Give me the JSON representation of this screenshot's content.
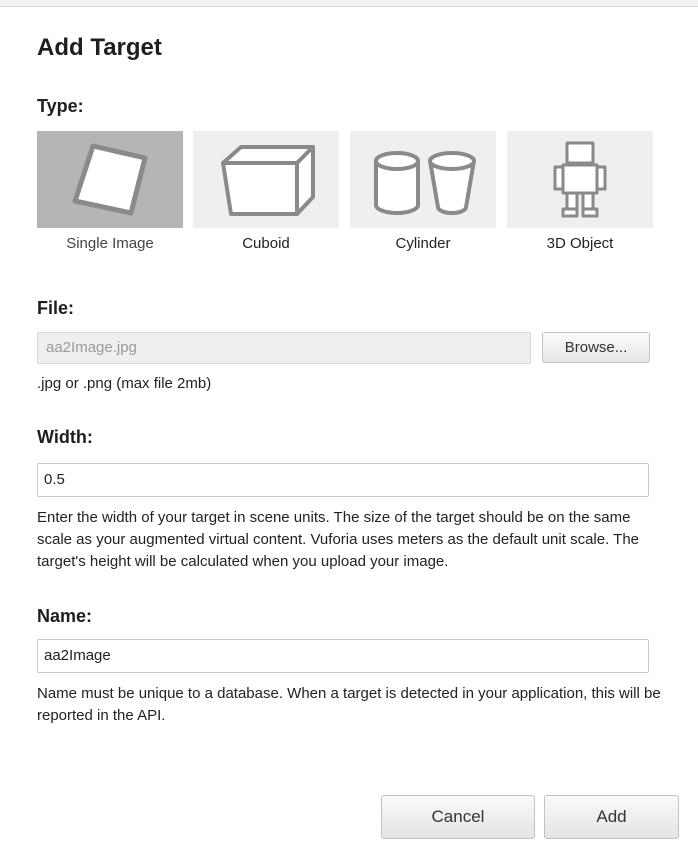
{
  "dialog": {
    "title": "Add Target"
  },
  "type_section": {
    "label": "Type:",
    "options": [
      {
        "label": "Single Image",
        "icon": "single-image-icon",
        "selected": true
      },
      {
        "label": "Cuboid",
        "icon": "cuboid-icon",
        "selected": false
      },
      {
        "label": "Cylinder",
        "icon": "cylinder-icon",
        "selected": false
      },
      {
        "label": "3D Object",
        "icon": "robot-3d-object-icon",
        "selected": false
      }
    ]
  },
  "file_section": {
    "label": "File:",
    "value": "aa2Image.jpg",
    "browse_label": "Browse...",
    "hint": ".jpg or .png (max file 2mb)"
  },
  "width_section": {
    "label": "Width:",
    "value": "0.5",
    "help": "Enter the width of your target in scene units. The size of the target should be on the same scale as your augmented virtual content. Vuforia uses meters as the default unit scale. The target's height will be calculated when you upload your image."
  },
  "name_section": {
    "label": "Name:",
    "value": "aa2Image",
    "help": "Name must be unique to a database. When a target is detected in your application, this will be reported in the API."
  },
  "footer": {
    "cancel_label": "Cancel",
    "add_label": "Add"
  },
  "colors": {
    "selected_tile": "#b5b5b5",
    "tile": "#efefef",
    "icon_stroke": "#8a8a8a"
  }
}
